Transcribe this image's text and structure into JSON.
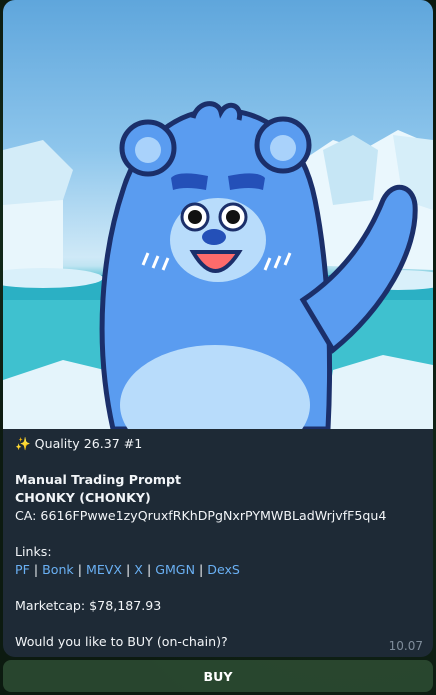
{
  "message": {
    "quality_line": "✨ Quality 26.37 #1",
    "title": "Manual Trading Prompt",
    "token": "CHONKY (CHONKY)",
    "ca": "CA: 6616FPwwe1zyQruxfRKhDPgNxrPYMWBLadWrjvfF5qu4",
    "links_label": "Links:",
    "links": [
      "PF",
      "Bonk",
      "MEVX",
      "X",
      "GMGN",
      "DexS"
    ],
    "link_separator": " | ",
    "marketcap": "Marketcap: $78,187.93",
    "prompt": "Would you like to BUY (on-chain)?",
    "time": "10.07"
  },
  "buttons": {
    "buy_label": "BUY"
  },
  "colors": {
    "bubble": "#1e2a36",
    "link": "#6ab0f3",
    "text": "#f2f5f8",
    "button": "#2e4e34"
  }
}
